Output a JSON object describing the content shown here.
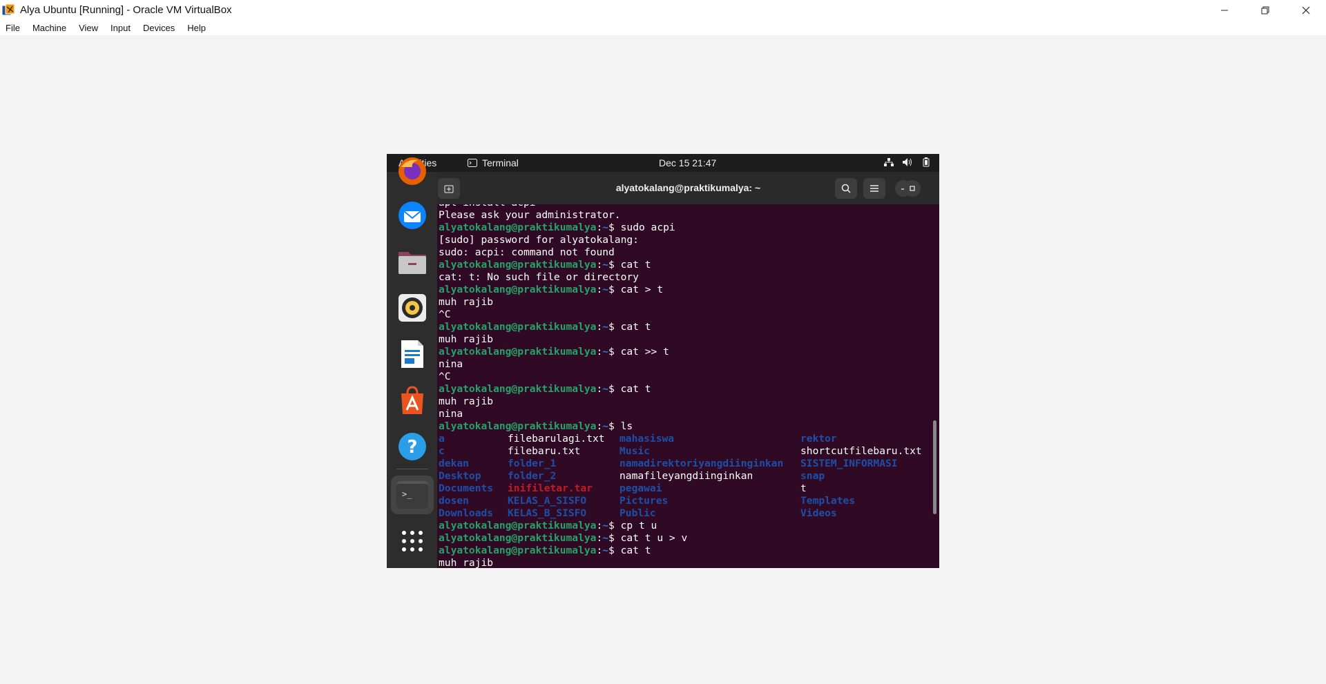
{
  "host_window": {
    "title": "Alya Ubuntu [Running] - Oracle VM VirtualBox",
    "menu": [
      "File",
      "Machine",
      "View",
      "Input",
      "Devices",
      "Help"
    ],
    "controls": [
      "minimize-icon",
      "restore-icon",
      "close-icon"
    ]
  },
  "ubuntu": {
    "topbar": {
      "activities": "Activities",
      "app": "Terminal",
      "clock": "Dec 15  21:47"
    },
    "tray": [
      "network-icon",
      "volume-icon",
      "battery-icon"
    ],
    "dock": [
      {
        "name": "firefox-icon",
        "color": "#e66000"
      },
      {
        "name": "thunderbird-icon",
        "color": "#0a84ff"
      },
      {
        "name": "files-icon",
        "color": "#8b4556"
      },
      {
        "name": "rhythmbox-icon",
        "color": "#f6c744"
      },
      {
        "name": "libreoffice-writer-icon",
        "color": "#1d79c9"
      },
      {
        "name": "app-center-icon",
        "color": "#e95420"
      },
      {
        "name": "help-icon",
        "color": "#2a9ee8"
      },
      {
        "name": "terminal-icon",
        "color": "#3b3b3b"
      },
      {
        "name": "show-apps-icon",
        "color": "#ffffff"
      }
    ]
  },
  "terminal": {
    "title": "alyatokalang@praktikumalya: ~",
    "prompt_user": "alyatokalang@praktikumalya",
    "prompt_path": "~",
    "prompt_sym": "$",
    "colors": {
      "bg": "#300a24",
      "user": "#26a269",
      "dir": "#1e4fa8",
      "archive": "#c01c28"
    },
    "lines_before": [
      {
        "type": "out",
        "text": "apt install acpi"
      },
      {
        "type": "out",
        "text": "Please ask your administrator."
      },
      {
        "type": "cmd",
        "text": " sudo acpi"
      },
      {
        "type": "out",
        "text": "[sudo] password for alyatokalang:"
      },
      {
        "type": "out",
        "text": "sudo: acpi: command not found"
      },
      {
        "type": "cmd",
        "text": " cat t"
      },
      {
        "type": "out",
        "text": "cat: t: No such file or directory"
      },
      {
        "type": "cmd",
        "text": " cat > t"
      },
      {
        "type": "out",
        "text": "muh rajib"
      },
      {
        "type": "out",
        "text": "^C"
      },
      {
        "type": "cmd",
        "text": " cat t"
      },
      {
        "type": "out",
        "text": "muh rajib"
      },
      {
        "type": "cmd",
        "text": " cat >> t"
      },
      {
        "type": "out",
        "text": "nina"
      },
      {
        "type": "out",
        "text": "^C"
      },
      {
        "type": "cmd",
        "text": " cat t"
      },
      {
        "type": "out",
        "text": "muh rajib"
      },
      {
        "type": "out",
        "text": "nina"
      },
      {
        "type": "cmd",
        "text": " ls"
      }
    ],
    "ls_rows": [
      [
        {
          "n": "a",
          "t": "dir"
        },
        {
          "n": "filebarulagi.txt",
          "t": "file"
        },
        {
          "n": "mahasiswa",
          "t": "dir"
        },
        {
          "n": "rektor",
          "t": "dir"
        }
      ],
      [
        {
          "n": "c",
          "t": "dir"
        },
        {
          "n": "filebaru.txt",
          "t": "file"
        },
        {
          "n": "Music",
          "t": "dir"
        },
        {
          "n": "shortcutfilebaru.txt",
          "t": "file"
        }
      ],
      [
        {
          "n": "dekan",
          "t": "dir"
        },
        {
          "n": "folder_1",
          "t": "dir"
        },
        {
          "n": "namadirektoriyangdiinginkan",
          "t": "dir"
        },
        {
          "n": "SISTEM_INFORMASI",
          "t": "dir"
        }
      ],
      [
        {
          "n": "Desktop",
          "t": "dir"
        },
        {
          "n": "folder_2",
          "t": "dir"
        },
        {
          "n": "namafileyangdiinginkan",
          "t": "file"
        },
        {
          "n": "snap",
          "t": "dir"
        }
      ],
      [
        {
          "n": "Documents",
          "t": "dir"
        },
        {
          "n": "inifiletar.tar",
          "t": "archive"
        },
        {
          "n": "pegawai",
          "t": "dir"
        },
        {
          "n": "t",
          "t": "file"
        }
      ],
      [
        {
          "n": "dosen",
          "t": "dir"
        },
        {
          "n": "KELAS_A_SISFO",
          "t": "dir"
        },
        {
          "n": "Pictures",
          "t": "dir"
        },
        {
          "n": "Templates",
          "t": "dir"
        }
      ],
      [
        {
          "n": "Downloads",
          "t": "dir"
        },
        {
          "n": "KELAS_B_SISFO",
          "t": "dir"
        },
        {
          "n": "Public",
          "t": "dir"
        },
        {
          "n": "Videos",
          "t": "dir"
        }
      ]
    ],
    "lines_after": [
      {
        "type": "cmd",
        "text": " cp t u"
      },
      {
        "type": "cmd",
        "text": " cat t u > v"
      },
      {
        "type": "cmd",
        "text": " cat t"
      },
      {
        "type": "out",
        "text": "muh rajib"
      }
    ]
  }
}
